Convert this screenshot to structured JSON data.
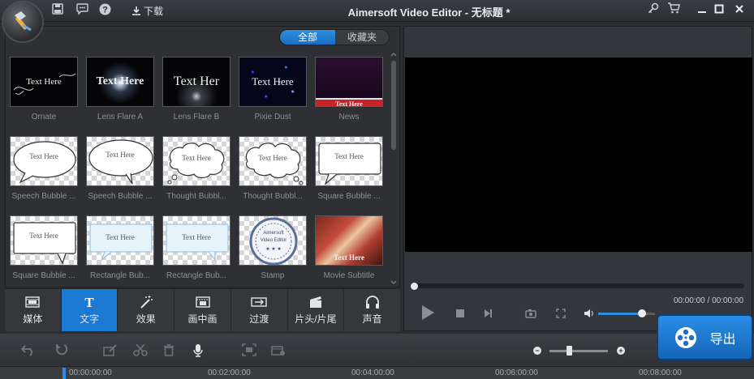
{
  "app": {
    "title": "Aimersoft Video Editor - 无标题 *"
  },
  "titlebar": {
    "download_label": "下载",
    "icons": [
      "save-icon",
      "feedback-icon",
      "help-icon",
      "download-icon",
      "key-icon",
      "cart-icon",
      "minimize-icon",
      "maximize-icon",
      "close-icon"
    ]
  },
  "library": {
    "filter_all": "全部",
    "filter_favorites": "收藏夹",
    "items": [
      {
        "label": "Ornate",
        "thumb_text": "Text Here"
      },
      {
        "label": "Lens Flare A",
        "thumb_text": "Text Here"
      },
      {
        "label": "Lens Flare B",
        "thumb_text": "Text Her"
      },
      {
        "label": "Pixie Dust",
        "thumb_text": "Text Here"
      },
      {
        "label": "News",
        "thumb_text": "Text Here"
      },
      {
        "label": "Speech Bubble ...",
        "thumb_text": "Text Here"
      },
      {
        "label": "Speech Bubble ...",
        "thumb_text": "Text Here"
      },
      {
        "label": "Thought Bubbl...",
        "thumb_text": "Text Here"
      },
      {
        "label": "Thought Bubbl...",
        "thumb_text": "Text Here"
      },
      {
        "label": "Square Bubble ...",
        "thumb_text": "Text Here"
      },
      {
        "label": "Square Bubble ...",
        "thumb_text": "Text Here"
      },
      {
        "label": "Rectangle Bub...",
        "thumb_text": "Text Here"
      },
      {
        "label": "Rectangle Bub...",
        "thumb_text": "Text Here"
      },
      {
        "label": "Stamp",
        "thumb_text": "Aimersoft Video Editor"
      },
      {
        "label": "Movie Subtitle",
        "thumb_text": "Text Here"
      }
    ]
  },
  "categories": [
    {
      "label": "媒体",
      "icon": "media-icon"
    },
    {
      "label": "文字",
      "icon": "text-icon",
      "active": true
    },
    {
      "label": "效果",
      "icon": "magic-wand-icon"
    },
    {
      "label": "画中画",
      "icon": "pip-icon"
    },
    {
      "label": "过渡",
      "icon": "transition-icon"
    },
    {
      "label": "片头/片尾",
      "icon": "clapper-icon"
    },
    {
      "label": "声音",
      "icon": "headphones-icon"
    }
  ],
  "preview": {
    "timecode": "00:00:00 / 00:00:00",
    "progress": 0,
    "volume": 0.77
  },
  "export": {
    "label": "导出"
  },
  "timeline": {
    "ticks": [
      "00:00:00:00",
      "00:02:00:00",
      "00:04:00:00",
      "00:06:00:00",
      "00:08:00:00"
    ],
    "zoom_level": 0.33
  }
}
